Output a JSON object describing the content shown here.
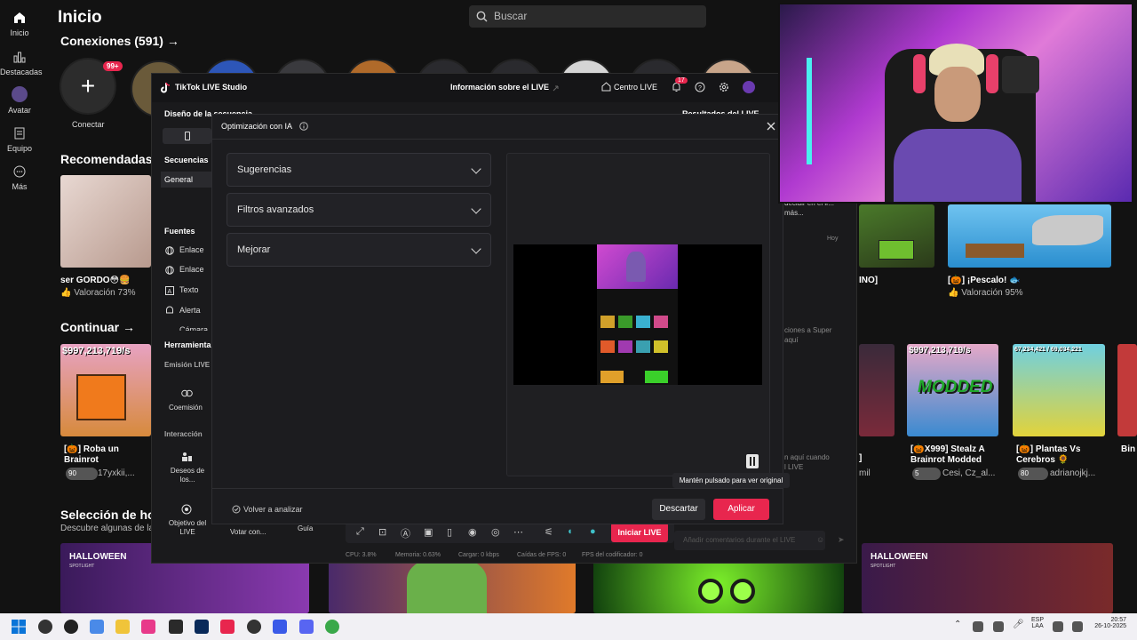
{
  "page": {
    "title": "Inicio"
  },
  "nav": [
    {
      "label": "Inicio",
      "icon": "home-icon"
    },
    {
      "label": "Destacadas",
      "icon": "chart-icon"
    },
    {
      "label": "Avatar",
      "icon": "avatar-icon"
    },
    {
      "label": "Equipo",
      "icon": "team-icon"
    },
    {
      "label": "Más",
      "icon": "more-icon"
    }
  ],
  "search": {
    "placeholder": "Buscar"
  },
  "connections": {
    "title": "Conexiones (591) →",
    "connect_label": "Conectar",
    "badge": "99+"
  },
  "sections": {
    "recommended": "Recomendadas",
    "continue": "Continuar →",
    "selection": "Selección de ho",
    "selection_sub": "Descubre algunas de la"
  },
  "cards": {
    "rec1": {
      "title": "ser GORDO😳🍔",
      "sub": "👍 Valoración 73%"
    },
    "rec2": {
      "title": "[🎃] ¡Pescalo! 🐟",
      "sub": "👍 Valoración 95%"
    },
    "rec_mid": "INO]",
    "cont1": {
      "title": "[🎃] Roba un Brainrot",
      "sub": "17yxkii,..."
    },
    "cont2": {
      "title": "[🎃X999] Stealz A Brainrot Modded",
      "sub": "Cesi, Cz_al..."
    },
    "cont3": {
      "title": "[🎃] Plantas Vs Cerebros 🌻",
      "sub": "adrianojkj..."
    },
    "cont4": "Bin",
    "cont_mid": "]",
    "cont_mid2": "mil",
    "thumb_amount": "$997,213,719/s",
    "thumb_amount2": "$997,213,719/s",
    "thumb_counter": "67,234,421 / 69,034,221",
    "modded": "MODDED",
    "halloween": "HALLOWEEN",
    "spotlight": "SPOTLIGHT",
    "count1": "90",
    "count2": "5",
    "count3": "80"
  },
  "studio": {
    "app_name": "TikTok LIVE Studio",
    "info": "Información sobre el LIVE",
    "center": "Centro LIVE",
    "notif_count": "17",
    "scene_design": "Diseño de la secuencia",
    "results": "Resultados del LIVE",
    "sequences": "Secuencias",
    "general": "General",
    "sources": "Fuentes",
    "source_items": [
      "Enlace",
      "Enlace",
      "Texto",
      "Alerta",
      "Cámara"
    ],
    "tools": "Herramienta",
    "emission": "Emisión LIVE c",
    "coemission": "Coemisión",
    "interaction": "Interacción",
    "wishes": "Deseos de los...",
    "objective": "Objetivo del LIVE",
    "vote": "Votar con...",
    "guide": "Guía",
    "start_live": "Iniciar LIVE",
    "comment_placeholder": "Añadir comentarios durante el LIVE",
    "right_text1": "decidir en el ir...",
    "right_text2": "más...",
    "right_today": "Hoy",
    "right_text3": "ciones a Super",
    "right_text4": "aquí",
    "right_text5": "n aquí cuando",
    "right_text6": "l LIVE",
    "stats": {
      "cpu": "CPU: 3.8%",
      "memory": "Memoria: 0.63%",
      "upload": "Cargar: 0 kbps",
      "fps_drops": "Caídas de FPS: 0",
      "encoder": "FPS del codificador: 0"
    }
  },
  "modal": {
    "title": "Optimización con IA",
    "accordions": [
      "Sugerencias",
      "Filtros avanzados",
      "Mejorar"
    ],
    "reanalyze": "Volver a analizar",
    "discard": "Descartar",
    "apply": "Aplicar",
    "tooltip": "Mantén pulsado para ver original"
  },
  "taskbar": {
    "lang": "ESP",
    "lang_sub": "LAA",
    "time": "20:57",
    "date": "26-10-2025"
  },
  "colors": {
    "accent": "#e8264e",
    "background": "#121212",
    "modal": "#1c1c1f"
  }
}
